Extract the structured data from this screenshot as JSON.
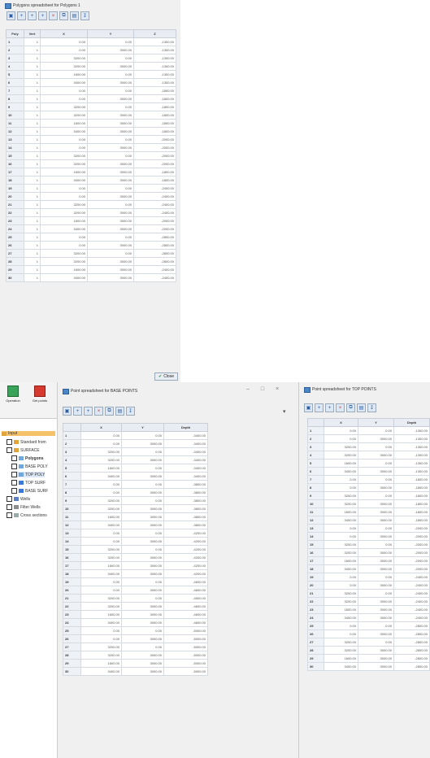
{
  "colors": {
    "accent": "#4a86c8",
    "selected": "#f5c26b",
    "panel": "#f0f0f0"
  },
  "polygon_window": {
    "title": "Polygons spreadsheet for Polygons 1",
    "headers": [
      "Poly",
      "Vert",
      "X",
      "Y",
      "Z"
    ],
    "rows": [
      [
        "1",
        "1",
        "0.00",
        "0.00",
        "-1300.00"
      ],
      [
        "2",
        "1",
        "0.00",
        "3000.00",
        "-1300.00"
      ],
      [
        "3",
        "1",
        "3200.00",
        "0.00",
        "-1300.00"
      ],
      [
        "4",
        "1",
        "3200.00",
        "3000.00",
        "-1300.00"
      ],
      [
        "5",
        "1",
        "1600.00",
        "0.00",
        "-1300.00"
      ],
      [
        "6",
        "1",
        "3400.00",
        "3000.00",
        "-1300.00"
      ],
      [
        "7",
        "1",
        "0.00",
        "0.00",
        "-1800.00"
      ],
      [
        "8",
        "1",
        "0.00",
        "3000.00",
        "-1800.00"
      ],
      [
        "9",
        "1",
        "3200.00",
        "0.00",
        "-1800.00"
      ],
      [
        "10",
        "1",
        "3200.00",
        "3000.00",
        "-1800.00"
      ],
      [
        "11",
        "1",
        "1600.00",
        "3000.00",
        "-1800.00"
      ],
      [
        "12",
        "1",
        "3400.00",
        "3000.00",
        "-1800.00"
      ],
      [
        "13",
        "1",
        "0.00",
        "0.00",
        "-2000.00"
      ],
      [
        "14",
        "1",
        "0.00",
        "3000.00",
        "-2000.00"
      ],
      [
        "15",
        "1",
        "3200.00",
        "0.00",
        "-2000.00"
      ],
      [
        "16",
        "1",
        "3200.00",
        "3000.00",
        "-2000.00"
      ],
      [
        "17",
        "1",
        "1600.00",
        "3000.00",
        "-1800.00"
      ],
      [
        "18",
        "1",
        "3400.00",
        "3000.00",
        "-1800.00"
      ],
      [
        "19",
        "1",
        "0.00",
        "0.00",
        "-2400.00"
      ],
      [
        "20",
        "1",
        "0.00",
        "3000.00",
        "-2400.00"
      ],
      [
        "21",
        "1",
        "3200.00",
        "0.00",
        "-2400.00"
      ],
      [
        "22",
        "1",
        "3200.00",
        "3000.00",
        "-2400.00"
      ],
      [
        "23",
        "1",
        "1600.00",
        "3000.00",
        "-2000.00"
      ],
      [
        "24",
        "1",
        "3400.00",
        "3000.00",
        "-2000.00"
      ],
      [
        "25",
        "1",
        "0.00",
        "0.00",
        "-2800.00"
      ],
      [
        "26",
        "1",
        "0.00",
        "3000.00",
        "-2800.00"
      ],
      [
        "27",
        "1",
        "3200.00",
        "0.00",
        "-2800.00"
      ],
      [
        "28",
        "1",
        "3200.00",
        "3000.00",
        "-2800.00"
      ],
      [
        "29",
        "1",
        "1600.00",
        "3000.00",
        "-2400.00"
      ],
      [
        "30",
        "1",
        "3400.00",
        "3000.00",
        "-2400.00"
      ]
    ],
    "ok_label": "Close"
  },
  "app": {
    "ribbon": [
      {
        "label": "Operation",
        "icon": "green-cube-icon"
      },
      {
        "label": "Get points",
        "icon": "red-points-icon"
      }
    ],
    "tree": [
      {
        "label": "Input",
        "level": 0,
        "selected": true,
        "icon": "folder-icon"
      },
      {
        "label": "Standard from",
        "level": 1,
        "icon": "folder-icon"
      },
      {
        "label": "SURFACE",
        "level": 1,
        "icon": "folder-icon"
      },
      {
        "label": "Polygons",
        "level": 2,
        "bold": true,
        "icon": "polygon-icon"
      },
      {
        "label": "BASE POLY",
        "level": 2,
        "icon": "polygon-icon"
      },
      {
        "label": "TOP POLY",
        "level": 2,
        "highlight": true,
        "icon": "polygon-icon"
      },
      {
        "label": "TOP SURF",
        "level": 2,
        "icon": "surface-icon"
      },
      {
        "label": "BASE SURF",
        "level": 2,
        "icon": "surface-icon"
      },
      {
        "label": "Wells",
        "level": 1,
        "icon": "wells-icon"
      },
      {
        "label": "Filter Wells",
        "level": 1,
        "icon": "filter-icon"
      },
      {
        "label": "Cross sections",
        "level": 1,
        "icon": "section-icon"
      }
    ]
  },
  "base_window": {
    "title": "Point spreadsheet for BASE POINTS",
    "controls": [
      "–",
      "□",
      "×"
    ],
    "headers": [
      "",
      "X",
      "Y",
      "Depth"
    ],
    "rows": [
      [
        "1",
        "0.00",
        "0.00",
        "-3400.00"
      ],
      [
        "2",
        "0.00",
        "3000.00",
        "-3400.00"
      ],
      [
        "3",
        "3200.00",
        "0.00",
        "-3400.00"
      ],
      [
        "4",
        "3200.00",
        "3000.00",
        "-3400.00"
      ],
      [
        "5",
        "1600.00",
        "0.00",
        "-3400.00"
      ],
      [
        "6",
        "3400.00",
        "3000.00",
        "-3400.00"
      ],
      [
        "7",
        "0.00",
        "0.00",
        "-3800.00"
      ],
      [
        "8",
        "0.00",
        "3000.00",
        "-3800.00"
      ],
      [
        "9",
        "3200.00",
        "0.00",
        "-3800.00"
      ],
      [
        "10",
        "3200.00",
        "3000.00",
        "-3800.00"
      ],
      [
        "11",
        "1600.00",
        "3000.00",
        "-3800.00"
      ],
      [
        "12",
        "3400.00",
        "3000.00",
        "-3800.00"
      ],
      [
        "13",
        "0.00",
        "0.00",
        "-4200.00"
      ],
      [
        "14",
        "0.00",
        "3000.00",
        "-4200.00"
      ],
      [
        "15",
        "3200.00",
        "0.00",
        "-4200.00"
      ],
      [
        "16",
        "3200.00",
        "3000.00",
        "-4200.00"
      ],
      [
        "17",
        "1600.00",
        "3000.00",
        "-4200.00"
      ],
      [
        "18",
        "3400.00",
        "3000.00",
        "-4200.00"
      ],
      [
        "19",
        "0.00",
        "0.00",
        "-4600.00"
      ],
      [
        "20",
        "0.00",
        "3000.00",
        "-4600.00"
      ],
      [
        "21",
        "3200.00",
        "0.00",
        "-4600.00"
      ],
      [
        "22",
        "3200.00",
        "3000.00",
        "-4600.00"
      ],
      [
        "23",
        "1600.00",
        "3000.00",
        "-4600.00"
      ],
      [
        "24",
        "3400.00",
        "3000.00",
        "-4600.00"
      ],
      [
        "25",
        "0.00",
        "0.00",
        "-5000.00"
      ],
      [
        "26",
        "0.00",
        "3000.00",
        "-5000.00"
      ],
      [
        "27",
        "3200.00",
        "0.00",
        "-5000.00"
      ],
      [
        "28",
        "3200.00",
        "3000.00",
        "-5000.00"
      ],
      [
        "29",
        "1600.00",
        "3000.00",
        "-5000.00"
      ],
      [
        "30",
        "3400.00",
        "3000.00",
        "-5000.00"
      ]
    ]
  },
  "top_window": {
    "title": "Point spreadsheet for TOP POINTS",
    "headers": [
      "",
      "X",
      "Y",
      "Depth"
    ],
    "rows": [
      [
        "1",
        "0.00",
        "0.00",
        "-1300.00"
      ],
      [
        "2",
        "0.00",
        "3000.00",
        "-1300.00"
      ],
      [
        "3",
        "3200.00",
        "0.00",
        "-1300.00"
      ],
      [
        "4",
        "3200.00",
        "3000.00",
        "-1300.00"
      ],
      [
        "5",
        "1600.00",
        "0.00",
        "-1300.00"
      ],
      [
        "6",
        "3400.00",
        "3000.00",
        "-1300.00"
      ],
      [
        "7",
        "0.00",
        "0.00",
        "-1800.00"
      ],
      [
        "8",
        "0.00",
        "3000.00",
        "-1800.00"
      ],
      [
        "9",
        "3200.00",
        "0.00",
        "-1800.00"
      ],
      [
        "10",
        "3200.00",
        "3000.00",
        "-1800.00"
      ],
      [
        "11",
        "1600.00",
        "3000.00",
        "-1800.00"
      ],
      [
        "12",
        "3400.00",
        "3000.00",
        "-1800.00"
      ],
      [
        "13",
        "0.00",
        "0.00",
        "-2000.00"
      ],
      [
        "14",
        "0.00",
        "3000.00",
        "-2000.00"
      ],
      [
        "15",
        "3200.00",
        "0.00",
        "-2000.00"
      ],
      [
        "16",
        "3200.00",
        "3000.00",
        "-2000.00"
      ],
      [
        "17",
        "1600.00",
        "3000.00",
        "-2000.00"
      ],
      [
        "18",
        "3400.00",
        "3000.00",
        "-2000.00"
      ],
      [
        "19",
        "0.00",
        "0.00",
        "-2400.00"
      ],
      [
        "20",
        "0.00",
        "3000.00",
        "-2400.00"
      ],
      [
        "21",
        "3200.00",
        "0.00",
        "-2400.00"
      ],
      [
        "22",
        "3200.00",
        "3000.00",
        "-2400.00"
      ],
      [
        "23",
        "1600.00",
        "3000.00",
        "-2400.00"
      ],
      [
        "24",
        "3400.00",
        "3000.00",
        "-2400.00"
      ],
      [
        "25",
        "0.00",
        "0.00",
        "-2800.00"
      ],
      [
        "26",
        "0.00",
        "3000.00",
        "-2800.00"
      ],
      [
        "27",
        "3200.00",
        "0.00",
        "-2800.00"
      ],
      [
        "28",
        "3200.00",
        "3000.00",
        "-2800.00"
      ],
      [
        "29",
        "1600.00",
        "3000.00",
        "-2800.00"
      ],
      [
        "30",
        "3400.00",
        "3000.00",
        "-2800.00"
      ]
    ]
  }
}
